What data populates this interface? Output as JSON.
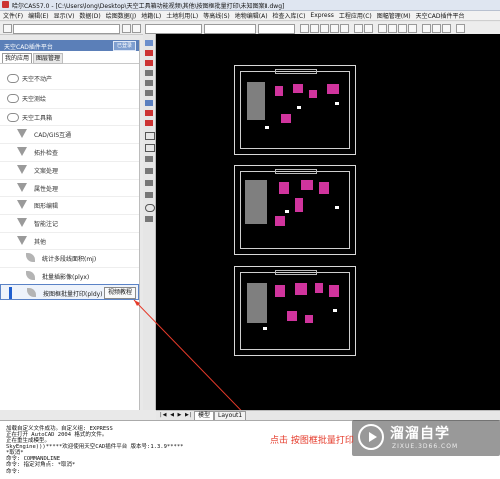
{
  "window": {
    "title": "哈尔CAS57.0 - [C:\\Users\\long\\Desktop\\天空工具箱功能视频\\其他\\按图框批量打印\\未知图案Ⅱ.dwg]"
  },
  "menu": [
    "文件(F)",
    "编辑(E)",
    "显示(V)",
    "数据(D)",
    "绘图数据(J)",
    "地籍(L)",
    "土地利用(L)",
    "等高线(S)",
    "地物编辑(A)",
    "检查入库(C)",
    "Express",
    "工程应用(C)",
    "图幅管理(M)",
    "天空CAD插件平台"
  ],
  "panel": {
    "title": "天空CAD插件平台",
    "login_button": "已登录",
    "tabs": [
      "我的应用",
      "图层管理"
    ],
    "items": [
      {
        "label": "天空不动产",
        "level": 0,
        "icon": "cloud-icon"
      },
      {
        "label": "天空测绘",
        "level": 0,
        "icon": "cloud-icon"
      },
      {
        "label": "天空工具箱",
        "level": 0,
        "icon": "cloud-icon"
      },
      {
        "label": "CAD/GIS互通",
        "level": 1,
        "icon": "triangle-icon"
      },
      {
        "label": "拓扑检查",
        "level": 1,
        "icon": "triangle-icon"
      },
      {
        "label": "文案处理",
        "level": 1,
        "icon": "triangle-icon"
      },
      {
        "label": "属性处理",
        "level": 1,
        "icon": "triangle-icon"
      },
      {
        "label": "图形编辑",
        "level": 1,
        "icon": "triangle-icon"
      },
      {
        "label": "智能注记",
        "level": 1,
        "icon": "triangle-icon"
      },
      {
        "label": "其他",
        "level": 1,
        "icon": "triangle-icon"
      },
      {
        "label": "统计多段线面积(mj)",
        "level": 2,
        "icon": "leaf-icon"
      },
      {
        "label": "批量插影像(plyx)",
        "level": 2,
        "icon": "leaf-icon"
      },
      {
        "label": "按图框批量打印(pldy)",
        "level": 2,
        "icon": "leaf-icon",
        "active": true,
        "action": "视频教程"
      }
    ]
  },
  "layout_tabs": {
    "model": "模型",
    "layout1": "Layout1"
  },
  "command_lines": [
    "加载自定义文件成功。自定义组: EXPRESS",
    "正在打开 AutoCAD 2004 格式的文件。",
    "正在重生成模型。",
    "SkyEngine)))*****欢迎使用天空CAD插件平台 版本号:1.3.9*****",
    "*取消*",
    "命令: COMMANDLINE",
    "命令: 指定对角点: *取消*",
    "命令:"
  ],
  "annotation": "点击 按图框批量打印",
  "watermark": {
    "name": "溜溜自学",
    "url": "ZIXUE.3D66.COM"
  },
  "colors": {
    "panel_header": "#5b7fb8",
    "drawing_bg": "#000000",
    "map_fill": "#d0349d",
    "annotation": "#e53a2a"
  }
}
